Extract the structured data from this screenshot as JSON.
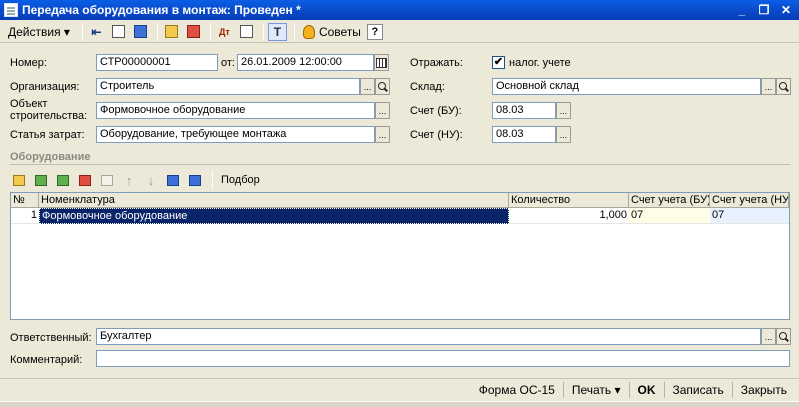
{
  "window": {
    "title": "Передача оборудования в монтаж: Проведен *"
  },
  "toolbar": {
    "actions_label": "Действия",
    "tips_label": "Советы",
    "help_label": "?"
  },
  "form": {
    "number_label": "Номер:",
    "number_value": "СТР00000001",
    "from_label": "от:",
    "date_value": "26.01.2009 12:00:00",
    "org_label": "Организация:",
    "org_value": "Строитель",
    "object_label_1": "Объект",
    "object_label_2": "строительства:",
    "object_value": "Формовочное оборудование",
    "cost_label": "Статья затрат:",
    "cost_value": "Оборудование, требующее монтажа",
    "reflect_label": "Отражать:",
    "tax_label": "налог. учете",
    "tax_checked": "✔",
    "warehouse_label": "Склад:",
    "warehouse_value": "Основной склад",
    "acc_bu_label": "Счет (БУ):",
    "acc_bu_value": "08.03",
    "acc_nu_label": "Счет (НУ):",
    "acc_nu_value": "08.03",
    "ellipsis": "..."
  },
  "equipment": {
    "section_title": "Оборудование",
    "pick_label": "Подбор",
    "columns": [
      "№",
      "Номенклатура",
      "Количество",
      "Счет учета (БУ)",
      "Счет учета (НУ)"
    ],
    "rows": [
      {
        "n": "1",
        "item": "Формовочное оборудование",
        "qty": "1,000",
        "acc_bu": "07",
        "acc_nu": "07"
      }
    ]
  },
  "bottom": {
    "responsible_label": "Ответственный:",
    "responsible_value": "Бухгалтер",
    "comment_label": "Комментарий:",
    "comment_value": ""
  },
  "footer": {
    "form_label": "Форма ОС-15",
    "print_label": "Печать",
    "ok_label": "OK",
    "save_label": "Записать",
    "close_label": "Закрыть"
  }
}
